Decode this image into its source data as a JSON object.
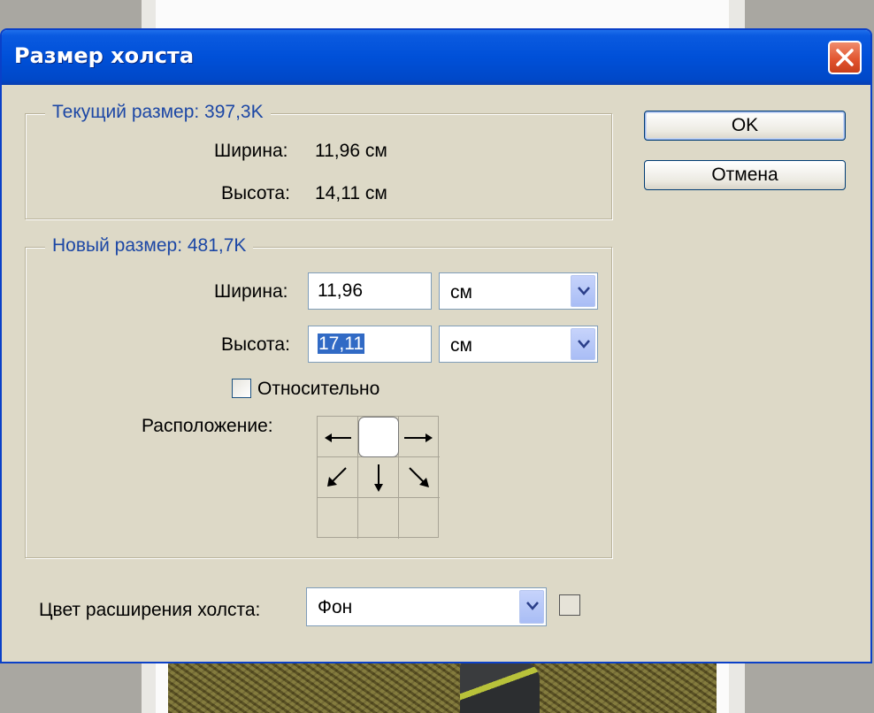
{
  "dialog": {
    "title": "Размер холста"
  },
  "buttons": {
    "ok": "OK",
    "cancel": "Отмена"
  },
  "current_size": {
    "legend": "Текущий размер: 397,3K",
    "width_label": "Ширина:",
    "width_value": "11,96 см",
    "height_label": "Высота:",
    "height_value": "14,11 см"
  },
  "new_size": {
    "legend": "Новый размер: 481,7K",
    "width_label": "Ширина:",
    "width_value": "11,96",
    "width_unit": "см",
    "height_label": "Высота:",
    "height_value": "17,11",
    "height_unit": "см",
    "relative_label": "Относительно",
    "relative_checked": false,
    "anchor_label": "Расположение:",
    "anchor_selected": "top-center"
  },
  "extension_color": {
    "label": "Цвет расширения холста:",
    "value": "Фон"
  },
  "colors": {
    "titlebar": "#0050d8",
    "dialog_bg": "#ddd9c7",
    "legend_text": "#1c47a5",
    "selection": "#316ac5"
  },
  "icons": [
    "close-icon",
    "chevron-down-icon",
    "arrow-left-icon",
    "arrow-right-icon",
    "arrow-down-left-icon",
    "arrow-down-icon",
    "arrow-down-right-icon"
  ]
}
